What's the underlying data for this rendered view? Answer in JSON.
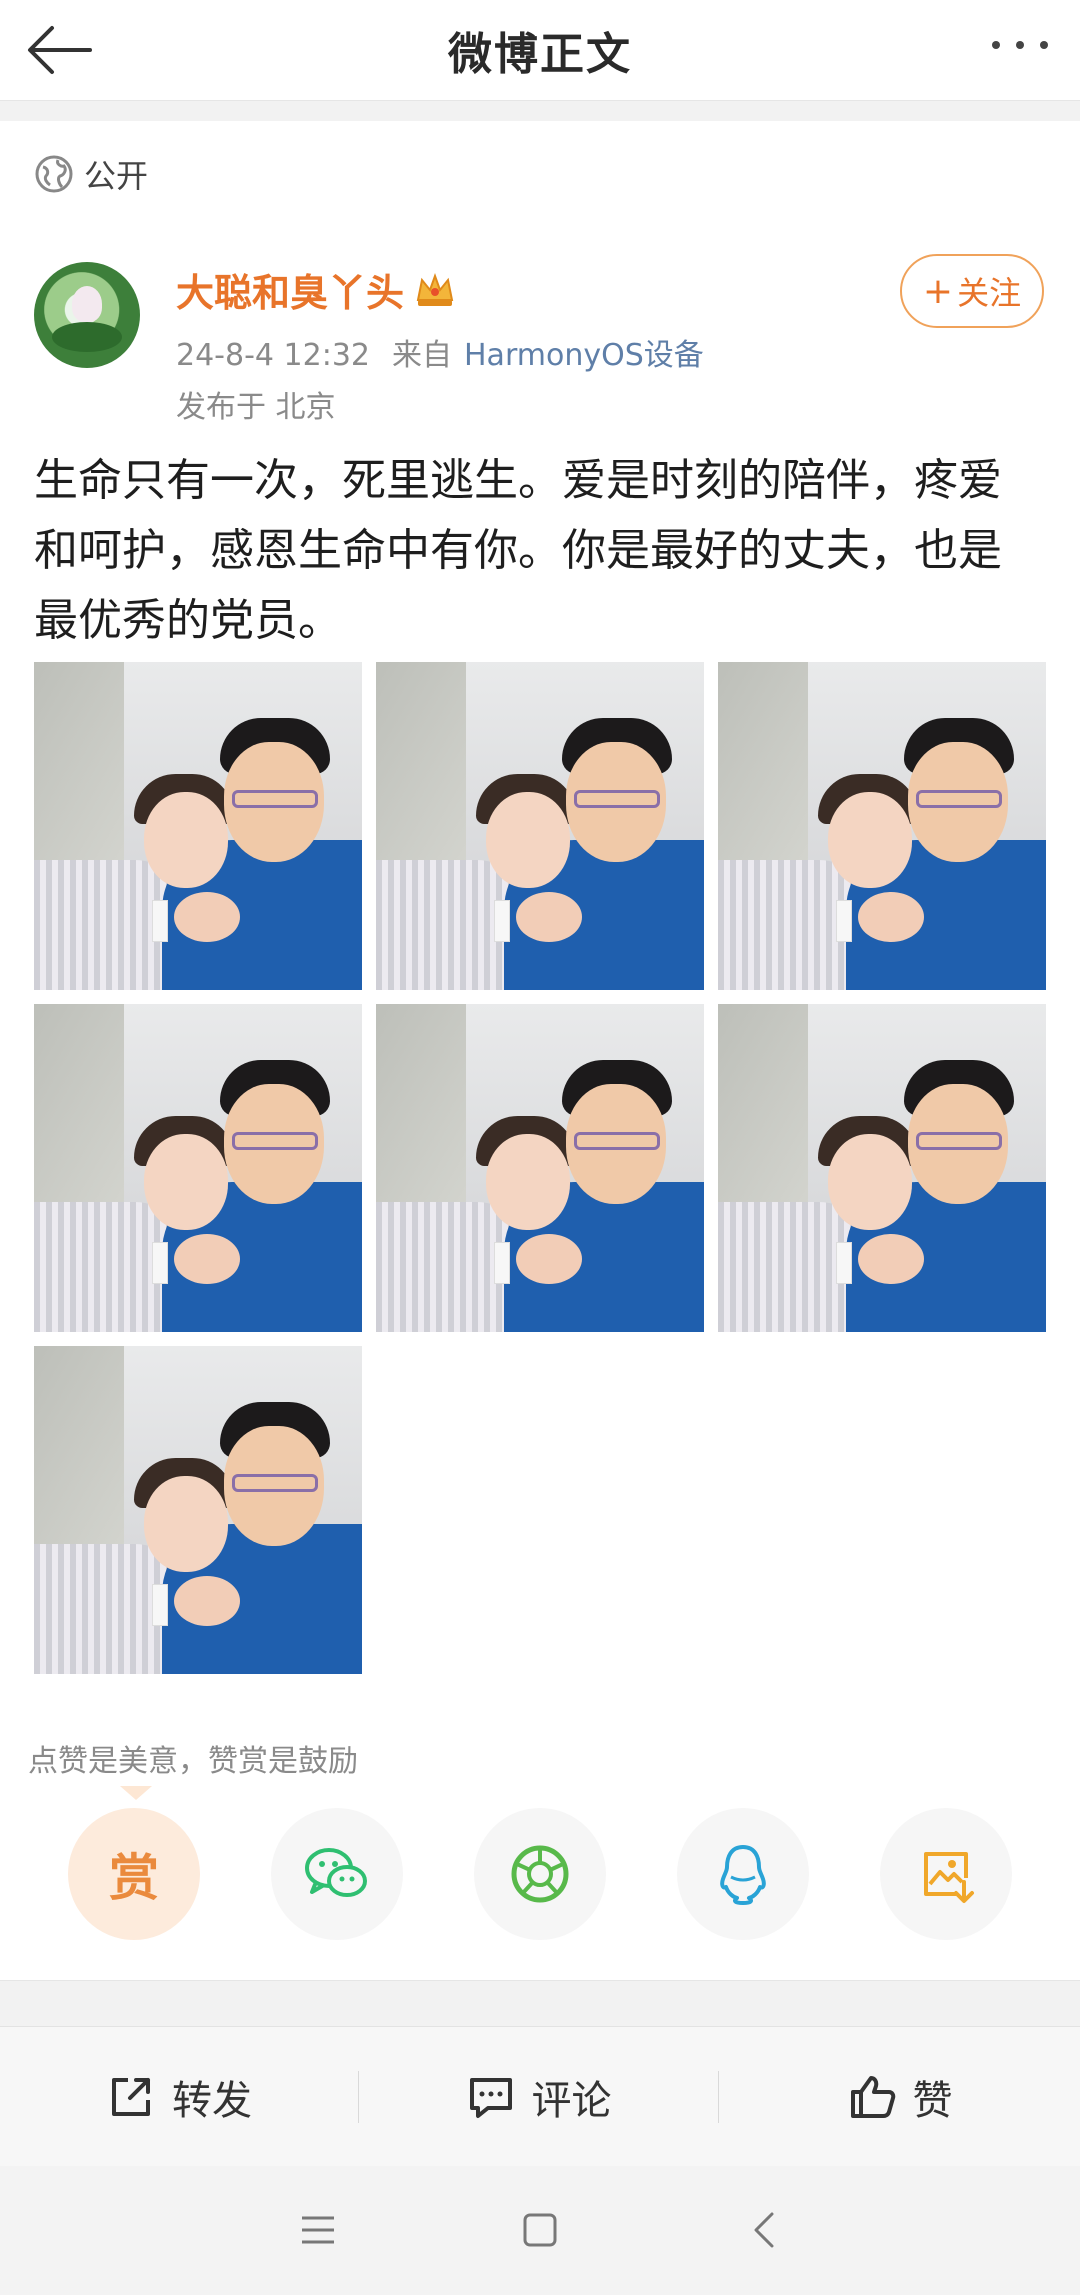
{
  "topbar": {
    "title": "微博正文"
  },
  "post": {
    "visibility": "公开",
    "author": {
      "name": "大聪和臭丫头"
    },
    "time": "24-8-4 12:32",
    "from_label": "来自",
    "source": "HarmonyOS设备",
    "location": "发布于 北京",
    "follow_label": "关注",
    "text_lines": [
      "生命只有一次，死里逃生。爱是时刻的陪伴，疼爱",
      "和呵护，感恩生命中有你。你是最好的丈夫，也是",
      "最优秀的党员。"
    ],
    "photo_count": 7
  },
  "reward": {
    "tip": "点赞是美意，赞赏是鼓励",
    "reward_label": "赏"
  },
  "share_icons": [
    "reward-icon",
    "wechat-icon",
    "moments-icon",
    "qq-icon",
    "save-image-icon"
  ],
  "actions": {
    "repost": "转发",
    "comment": "评论",
    "like": "赞"
  },
  "colors": {
    "accent_orange": "#e8742a",
    "link_blue": "#5f7fa8",
    "wechat_green": "#2fbf71",
    "qq_blue": "#29a3d6",
    "save_yellow": "#f0a72a"
  }
}
